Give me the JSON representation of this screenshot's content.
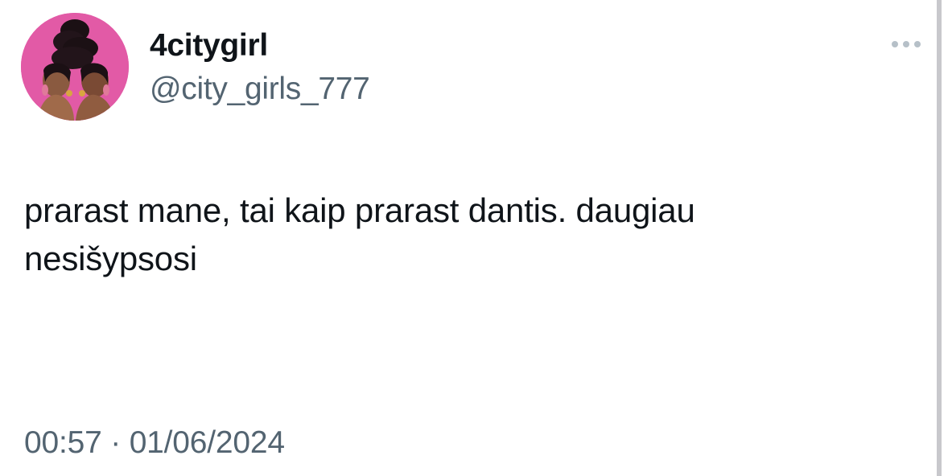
{
  "tweet": {
    "author": {
      "display_name": "4citygirl",
      "handle": "@city_girls_777",
      "avatar_icon": "profile-photo",
      "avatar_bg_color": "#e25aa6"
    },
    "more_icon": "more-options-icon",
    "text_line_1": "prarast mane, tai kaip prarast dantis. daugiau",
    "text_line_2": "nesišypsosi",
    "time": "00:57",
    "separator": "·",
    "date": "01/06/2024"
  },
  "colors": {
    "primary_text": "#0f1419",
    "secondary_text": "#536471",
    "background": "#ffffff"
  }
}
